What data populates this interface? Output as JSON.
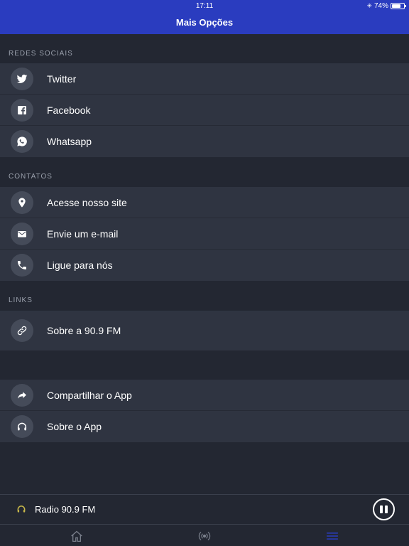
{
  "status_bar": {
    "time": "17:11",
    "battery": "74%",
    "battery_level": 0.74
  },
  "header": {
    "title": "Mais Opções"
  },
  "sections": [
    {
      "label": "REDES SOCIAIS",
      "items": [
        {
          "label": "Twitter",
          "icon": "twitter-icon"
        },
        {
          "label": "Facebook",
          "icon": "facebook-icon"
        },
        {
          "label": "Whatsapp",
          "icon": "whatsapp-icon"
        }
      ]
    },
    {
      "label": "CONTATOS",
      "items": [
        {
          "label": "Acesse nosso site",
          "icon": "location-pin-icon"
        },
        {
          "label": "Envie um e-mail",
          "icon": "mail-icon"
        },
        {
          "label": "Ligue para nós",
          "icon": "phone-icon"
        }
      ]
    },
    {
      "label": "LINKS",
      "items": [
        {
          "label": "Sobre a 90.9 FM",
          "icon": "link-icon"
        }
      ]
    },
    {
      "label": "",
      "items": [
        {
          "label": "Compartilhar o App",
          "icon": "share-icon"
        },
        {
          "label": "Sobre o App",
          "icon": "headphones-icon"
        }
      ]
    }
  ],
  "player": {
    "station": "Radio 90.9 FM",
    "state_icon": "pause-icon"
  },
  "tabbar": {
    "tabs": [
      {
        "icon": "home-icon",
        "active": false
      },
      {
        "icon": "broadcast-icon",
        "active": false
      },
      {
        "icon": "menu-icon",
        "active": true
      }
    ]
  },
  "colors": {
    "header": "#2a3cbf",
    "background": "#232732",
    "row": "#2f3441",
    "icon_circle": "#454b59",
    "active_tab": "#2a3cbf",
    "inactive_tab": "#7b808c",
    "player_icon": "#c8b84a"
  }
}
